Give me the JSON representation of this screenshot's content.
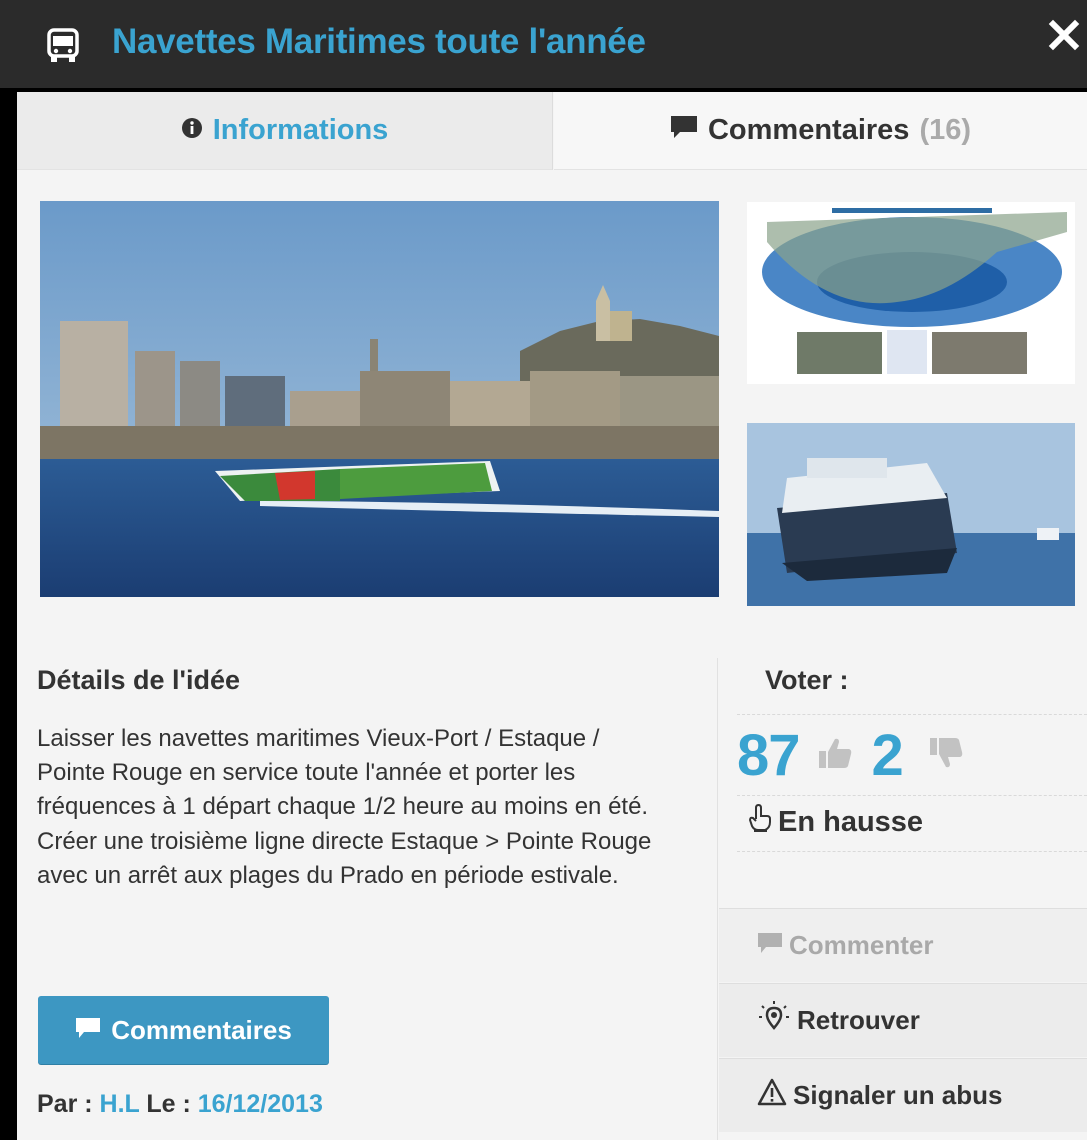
{
  "header": {
    "title": "Navettes Maritimes toute l'année",
    "icon": "bus-icon",
    "close_icon": "close-icon"
  },
  "tabs": {
    "info_label": "Informations",
    "comments_label": "Commentaires",
    "comments_count": "(16)"
  },
  "details": {
    "title": "Détails de l'idée",
    "text": "Laisser les navettes maritimes Vieux-Port / Estaque / Pointe Rouge en service toute l'année et porter les fréquences à 1 départ chaque 1/2 heure au moins en été. Créer une troisième ligne directe Estaque > Pointe Rouge avec un arrêt aux plages du Prado en période estivale.",
    "comments_button": "Commentaires",
    "author_prefix": "Par :",
    "author": "H.L",
    "date_prefix": "Le :",
    "date": "16/12/2013"
  },
  "vote": {
    "label": "Voter :",
    "up_count": "87",
    "down_count": "2",
    "trend": "En hausse"
  },
  "actions": {
    "comment": "Commenter",
    "locate": "Retrouver",
    "report": "Signaler un abus"
  },
  "colors": {
    "accent": "#3aa3d0",
    "header_bg": "#2b2b2b",
    "button_bg": "#3d97c2"
  }
}
